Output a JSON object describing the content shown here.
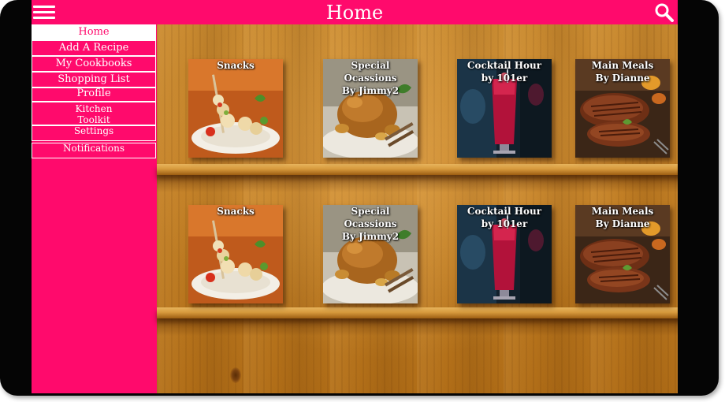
{
  "header": {
    "title": "Home",
    "menu_icon": "hamburger-menu-icon",
    "search_icon": "magnifier-search-icon"
  },
  "colors": {
    "accent": "#ff0a6c",
    "wood": "#c27f25",
    "text_light": "#ffffff"
  },
  "sidebar": {
    "items": [
      {
        "label": "Home",
        "active": true
      },
      {
        "label": "Add A Recipe"
      },
      {
        "label": "My Cookbooks"
      },
      {
        "label": "Shopping List"
      },
      {
        "label": "Profile"
      },
      {
        "label": "Kitchen Toolkit",
        "line1": "Kitchen",
        "line2": "Toolkit"
      },
      {
        "label": "Settings"
      },
      {
        "label": "Notifications"
      }
    ]
  },
  "shelves": [
    {
      "books": [
        {
          "title": "Snacks",
          "line1": "Snacks",
          "line2": ""
        },
        {
          "title": "Special Ocassions By Jimmy2",
          "line1": "Special Ocassions",
          "line2": "By Jimmy2"
        },
        {
          "title": "Cocktail Hour by 101er",
          "line1": "Cocktail Hour",
          "line2": "by 101er"
        },
        {
          "title": "Main Meals By Dianne",
          "line1": "Main Meals",
          "line2": "By Dianne"
        }
      ]
    },
    {
      "books": [
        {
          "title": "Snacks",
          "line1": "Snacks",
          "line2": ""
        },
        {
          "title": "Special Ocassions By Jimmy2",
          "line1": "Special Ocassions",
          "line2": "By Jimmy2"
        },
        {
          "title": "Cocktail Hour by 101er",
          "line1": "Cocktail Hour",
          "line2": "by 101er"
        },
        {
          "title": "Main Meals By Dianne",
          "line1": "Main Meals",
          "line2": "By Dianne"
        }
      ]
    }
  ]
}
